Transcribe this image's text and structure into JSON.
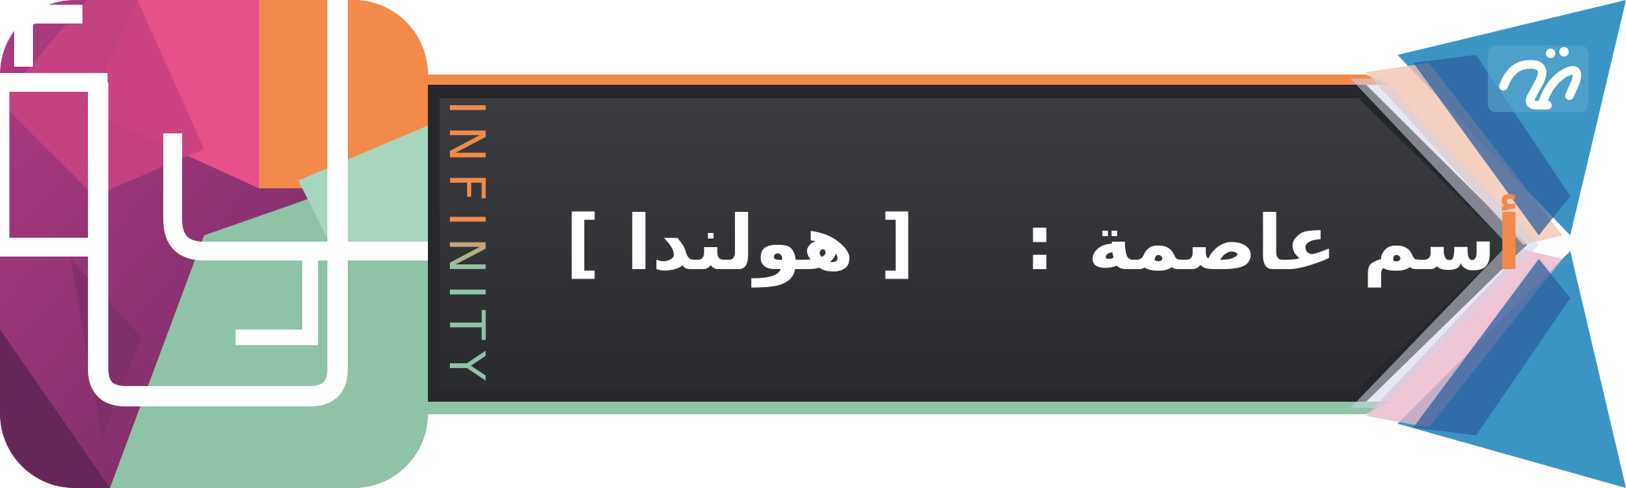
{
  "brand": {
    "logo_letters": "it",
    "vertical_word": "INFINITY",
    "colors": {
      "orange": "#f28a4b",
      "mint": "#8fc3a8",
      "magenta": "#a0377a",
      "pink": "#e8508a",
      "dark_panel": "#333438",
      "blue": "#3a95c4"
    }
  },
  "card": {
    "label_accent": "أ",
    "label_rest": "سم عاصمة",
    "separator": ":",
    "answer": "[ هولندا ]"
  },
  "corner_badge": {
    "icon": "publisher-mark-icon"
  }
}
